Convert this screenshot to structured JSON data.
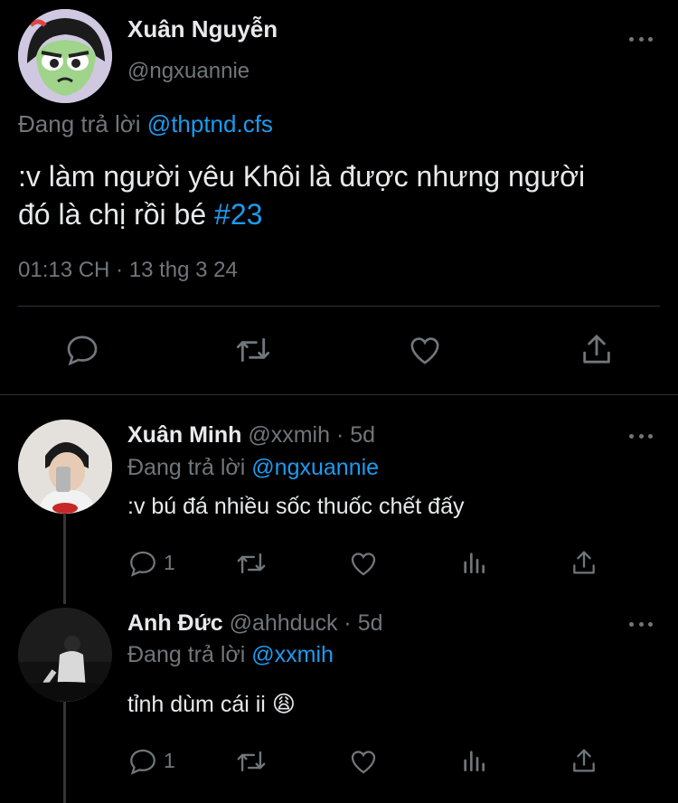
{
  "main_tweet": {
    "author_name": "Xuân Nguyễn",
    "author_handle": "@ngxuannie",
    "reply_prefix": "Đang trả lời",
    "reply_to": "@thptnd.cfs",
    "text_line1": ":v làm người yêu Khôi là được nhưng người",
    "text_line2": "đó là chị rồi bé",
    "hashtag": "#23",
    "time": "01:13 CH",
    "date": "13 thg 3 24"
  },
  "replies": [
    {
      "author_name": "Xuân Minh",
      "author_handle": "@xxmih",
      "age": "5d",
      "reply_prefix": "Đang trả lời",
      "reply_to": "@ngxuannie",
      "text": ":v bú đá nhiều sốc thuốc chết đấy",
      "reply_count": "1"
    },
    {
      "author_name": "Anh Đức",
      "author_handle": "@ahhduck",
      "age": "5d",
      "reply_prefix": "Đang trả lời",
      "reply_to": "@xxmih",
      "text": "tỉnh dùm cái ii",
      "emoji": "😩",
      "reply_count": "1"
    }
  ],
  "separator": "·",
  "colors": {
    "background": "#000000",
    "text": "#e7e9ea",
    "secondary": "#71767b",
    "accent": "#1d9bf0"
  }
}
